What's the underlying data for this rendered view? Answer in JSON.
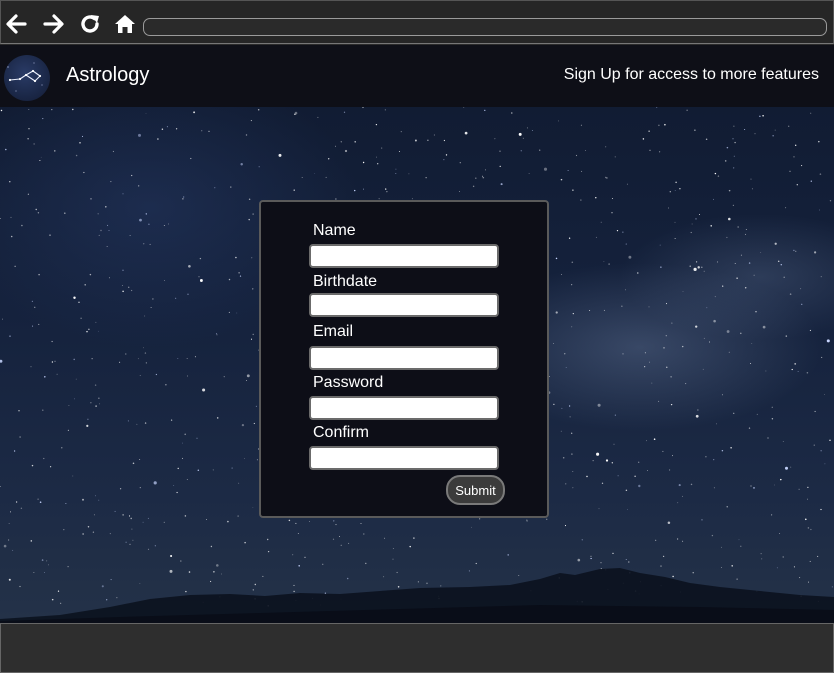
{
  "browser": {
    "url": "",
    "icons": [
      "back-arrow-icon",
      "forward-arrow-icon",
      "refresh-icon",
      "home-icon"
    ]
  },
  "header": {
    "brand": "Astrology",
    "signup_link": "Sign Up for access to more features"
  },
  "form": {
    "fields": [
      {
        "label": "Name",
        "value": ""
      },
      {
        "label": "Birthdate",
        "value": ""
      },
      {
        "label": "Email",
        "value": ""
      },
      {
        "label": "Password",
        "value": ""
      },
      {
        "label": "Confirm",
        "value": ""
      }
    ],
    "submit_label": "Submit"
  },
  "colors": {
    "header_bg": "#0e0f17",
    "card_bg": "#0d0e17",
    "footer_bg": "#2e2e2e"
  }
}
